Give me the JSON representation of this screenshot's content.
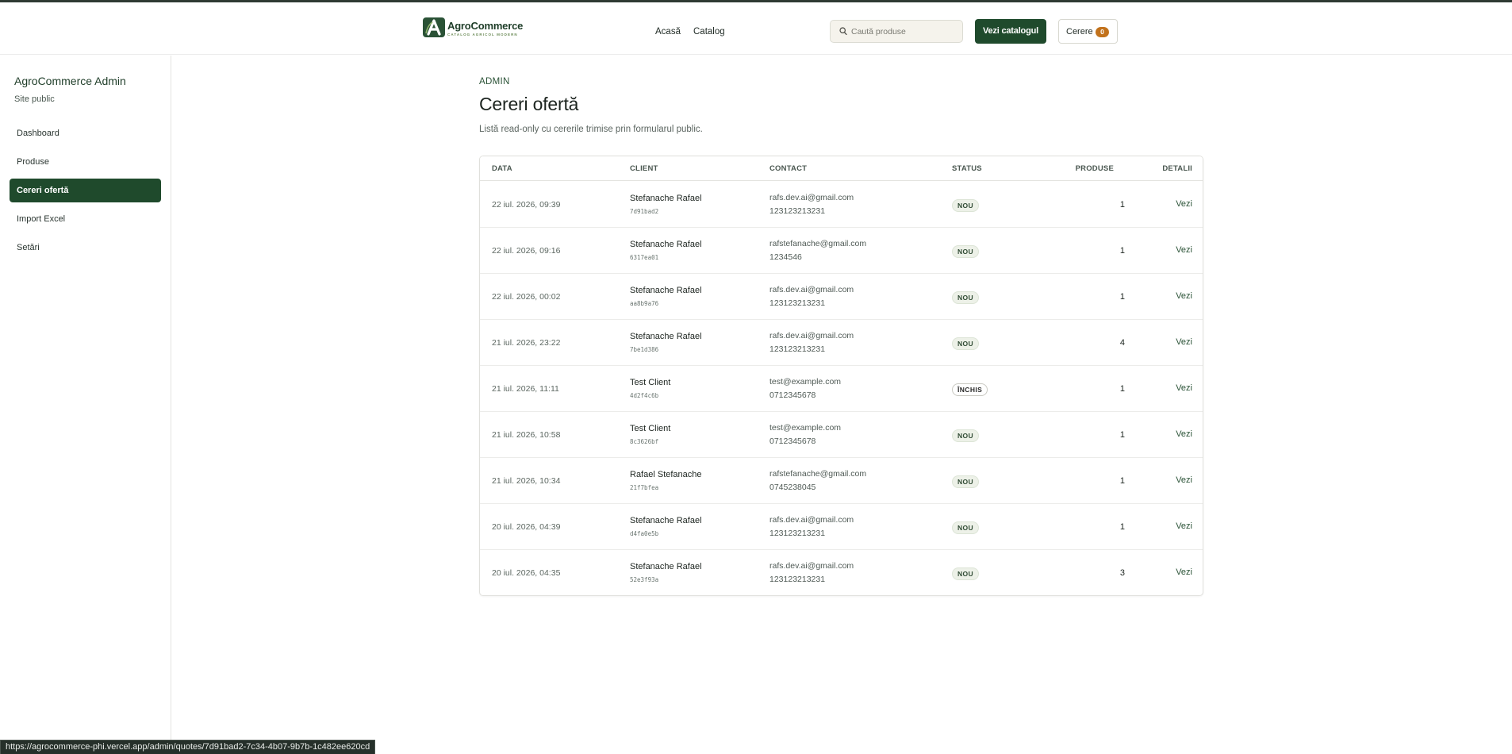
{
  "header": {
    "brand": "AgroCommerce",
    "tagline": "CATALOG AGRICOL MODERN",
    "nav": [
      {
        "label": "Acasă"
      },
      {
        "label": "Catalog"
      }
    ],
    "search_placeholder": "Caută produse",
    "catalog_button": "Vezi catalogul",
    "cart_label": "Cerere",
    "cart_count": "0"
  },
  "sidebar": {
    "title": "AgroCommerce Admin",
    "subtitle": "Site public",
    "items": [
      {
        "label": "Dashboard"
      },
      {
        "label": "Produse"
      },
      {
        "label": "Cereri ofertă"
      },
      {
        "label": "Import Excel"
      },
      {
        "label": "Setări"
      }
    ],
    "active": "Cereri ofertă"
  },
  "main": {
    "eyebrow": "ADMIN",
    "title": "Cereri ofertă",
    "description": "Listă read-only cu cererile trimise prin formularul public."
  },
  "table": {
    "columns": [
      "DATA",
      "CLIENT",
      "CONTACT",
      "STATUS",
      "PRODUSE",
      "DETALII"
    ],
    "rows": [
      {
        "date": "22 iul. 2026, 09:39",
        "name": "Stefanache Rafael",
        "id": "7d91bad2",
        "email": "rafs.dev.ai@gmail.com",
        "phone": "123123213231",
        "status": "NOU",
        "products": "1",
        "link": "Vezi"
      },
      {
        "date": "22 iul. 2026, 09:16",
        "name": "Stefanache Rafael",
        "id": "6317ea01",
        "email": "rafstefanache@gmail.com",
        "phone": "1234546",
        "status": "NOU",
        "products": "1",
        "link": "Vezi"
      },
      {
        "date": "22 iul. 2026, 00:02",
        "name": "Stefanache Rafael",
        "id": "aa8b9a76",
        "email": "rafs.dev.ai@gmail.com",
        "phone": "123123213231",
        "status": "NOU",
        "products": "1",
        "link": "Vezi"
      },
      {
        "date": "21 iul. 2026, 23:22",
        "name": "Stefanache Rafael",
        "id": "7be1d386",
        "email": "rafs.dev.ai@gmail.com",
        "phone": "123123213231",
        "status": "NOU",
        "products": "4",
        "link": "Vezi"
      },
      {
        "date": "21 iul. 2026, 11:11",
        "name": "Test Client",
        "id": "4d2f4c6b",
        "email": "test@example.com",
        "phone": "0712345678",
        "status": "ÎNCHIS",
        "products": "1",
        "link": "Vezi"
      },
      {
        "date": "21 iul. 2026, 10:58",
        "name": "Test Client",
        "id": "8c3626bf",
        "email": "test@example.com",
        "phone": "0712345678",
        "status": "NOU",
        "products": "1",
        "link": "Vezi"
      },
      {
        "date": "21 iul. 2026, 10:34",
        "name": "Rafael Stefanache",
        "id": "21f7bfea",
        "email": "rafstefanache@gmail.com",
        "phone": "0745238045",
        "status": "NOU",
        "products": "1",
        "link": "Vezi"
      },
      {
        "date": "20 iul. 2026, 04:39",
        "name": "Stefanache Rafael",
        "id": "d4fa0e5b",
        "email": "rafs.dev.ai@gmail.com",
        "phone": "123123213231",
        "status": "NOU",
        "products": "1",
        "link": "Vezi"
      },
      {
        "date": "20 iul. 2026, 04:35",
        "name": "Stefanache Rafael",
        "id": "52e3f93a",
        "email": "rafs.dev.ai@gmail.com",
        "phone": "123123213231",
        "status": "NOU",
        "products": "3",
        "link": "Vezi"
      }
    ]
  },
  "statusbar": {
    "url": "https://agrocommerce-phi.vercel.app/admin/quotes/7d91bad2-7c34-4b07-9b7b-1c482ee620cd"
  },
  "colors": {
    "brand_green": "#1f4a2c",
    "badge_orange": "#c2721c",
    "status_new_bg": "#edf1e8"
  }
}
